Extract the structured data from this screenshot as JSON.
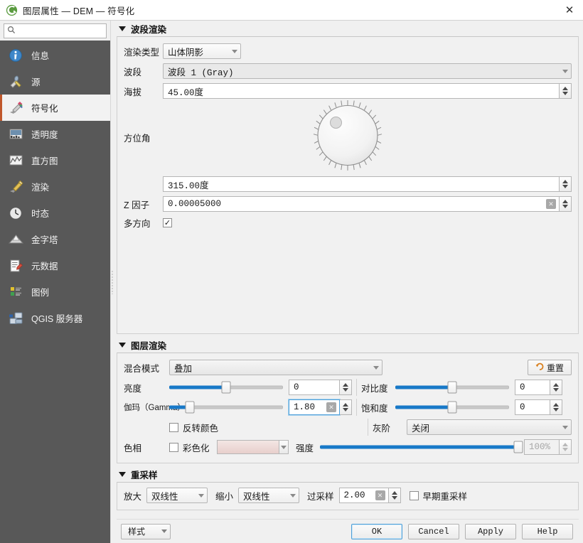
{
  "window": {
    "title": "图层属性 — DEM — 符号化",
    "logo_icon": "qgis-logo-icon",
    "close_icon": "close-icon"
  },
  "sidebar": {
    "search": {
      "placeholder": "",
      "value": "",
      "icon": "search-icon"
    },
    "items": [
      {
        "label": "信息",
        "icon": "info-icon",
        "selected": false
      },
      {
        "label": "源",
        "icon": "source-wrench-icon",
        "selected": false
      },
      {
        "label": "符号化",
        "icon": "symbology-brush-icon",
        "selected": true
      },
      {
        "label": "透明度",
        "icon": "transparency-icon",
        "selected": false
      },
      {
        "label": "直方图",
        "icon": "histogram-icon",
        "selected": false
      },
      {
        "label": "渲染",
        "icon": "rendering-brush-icon",
        "selected": false
      },
      {
        "label": "时态",
        "icon": "temporal-clock-icon",
        "selected": false
      },
      {
        "label": "金字塔",
        "icon": "pyramids-icon",
        "selected": false
      },
      {
        "label": "元数据",
        "icon": "metadata-icon",
        "selected": false
      },
      {
        "label": "图例",
        "icon": "legend-icon",
        "selected": false
      },
      {
        "label": "QGIS 服务器",
        "icon": "qgis-server-icon",
        "selected": false
      }
    ]
  },
  "band_rendering": {
    "title": "波段渲染",
    "render_type_label": "渲染类型",
    "render_type_value": "山体阴影",
    "band_label": "波段",
    "band_value": "波段 1 (Gray)",
    "altitude_label": "海拔",
    "altitude_value": "45.00度",
    "azimuth_label": "方位角",
    "azimuth_value": "315.00度",
    "azimuth_dial_name": "azimuth-dial",
    "z_factor_label": "Z 因子",
    "z_factor_value": "0.00005000",
    "multidirectional_label": "多方向",
    "multidirectional_checked": true
  },
  "layer_rendering": {
    "title": "图层渲染",
    "blend_mode_label": "混合模式",
    "blend_mode_value": "叠加",
    "reset_label": "重置",
    "reset_icon": "undo-arrow-icon",
    "brightness_label": "亮度",
    "brightness_value": "0",
    "brightness_pct": 50,
    "contrast_label": "对比度",
    "contrast_value": "0",
    "contrast_pct": 50,
    "gamma_label": "伽玛（Gamma）",
    "gamma_value": "1.80",
    "gamma_pct": 18,
    "saturation_label": "饱和度",
    "saturation_value": "0",
    "saturation_pct": 50,
    "invert_colors_label": "反转颜色",
    "invert_colors_checked": false,
    "grayscale_label": "灰阶",
    "grayscale_value": "关闭",
    "hue_label": "色相",
    "colorize_label": "彩色化",
    "colorize_checked": false,
    "colorize_color": "#ecd8d5",
    "strength_label": "强度",
    "strength_value": "100%",
    "strength_pct": 100,
    "accent_color": "#1879c8"
  },
  "resampling": {
    "title": "重采样",
    "zoom_in_label": "放大",
    "zoom_in_value": "双线性",
    "zoom_out_label": "缩小",
    "zoom_out_value": "双线性",
    "oversampling_label": "过采样",
    "oversampling_value": "2.00",
    "early_resample_label": "早期重采样",
    "early_resample_checked": false
  },
  "buttons": {
    "style_label": "样式",
    "ok_label": "OK",
    "cancel_label": "Cancel",
    "apply_label": "Apply",
    "help_label": "Help"
  }
}
